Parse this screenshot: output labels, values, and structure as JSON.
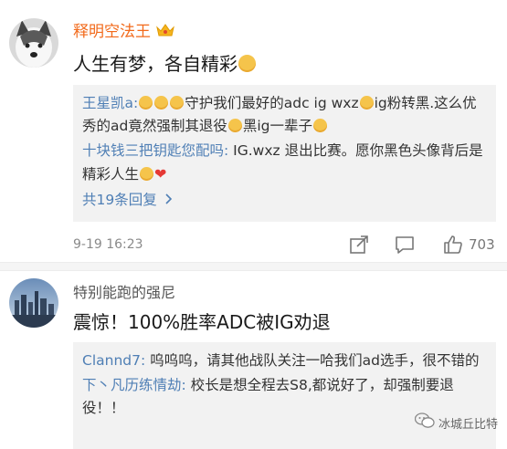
{
  "comments": [
    {
      "author": "释明空法王",
      "text": "人生有梦，各自精彩",
      "replies": [
        {
          "user": "王星凯a:",
          "text": "守护我们最好的adc ig wxz",
          "text2": "ig粉转黑.这么优秀的ad竟然强制其退役",
          "text3": "黑ig一辈子"
        },
        {
          "user": "十块钱三把钥匙您配吗:",
          "text": " IG.wxz 退出比赛。愿你黑色头像背后是精彩人生"
        }
      ],
      "more": "共19条回复",
      "time": "9-19 16:23",
      "likes": "703"
    },
    {
      "author": "特别能跑的强尼",
      "text": "震惊！100%胜率ADC被IG劝退",
      "replies": [
        {
          "user": "Clannd7:",
          "text": " 呜呜呜，请其他战队关注一哈我们ad选手，很不错的"
        },
        {
          "user": "下丶凡历练情劫:",
          "text": " 校长是想全程去S8,都说好了，却强制要退役！！"
        }
      ]
    }
  ],
  "watermark": "冰城丘比特",
  "icons": {
    "crown": "crown-icon",
    "share": "share-icon",
    "comment": "comment-icon",
    "like": "thumbs-up-icon",
    "chevron": "chevron-right-icon",
    "wechat": "wechat-icon"
  },
  "colors": {
    "author": "#f26a1b",
    "link": "#4f7fb5",
    "reply_bg": "#f2f2f2"
  }
}
